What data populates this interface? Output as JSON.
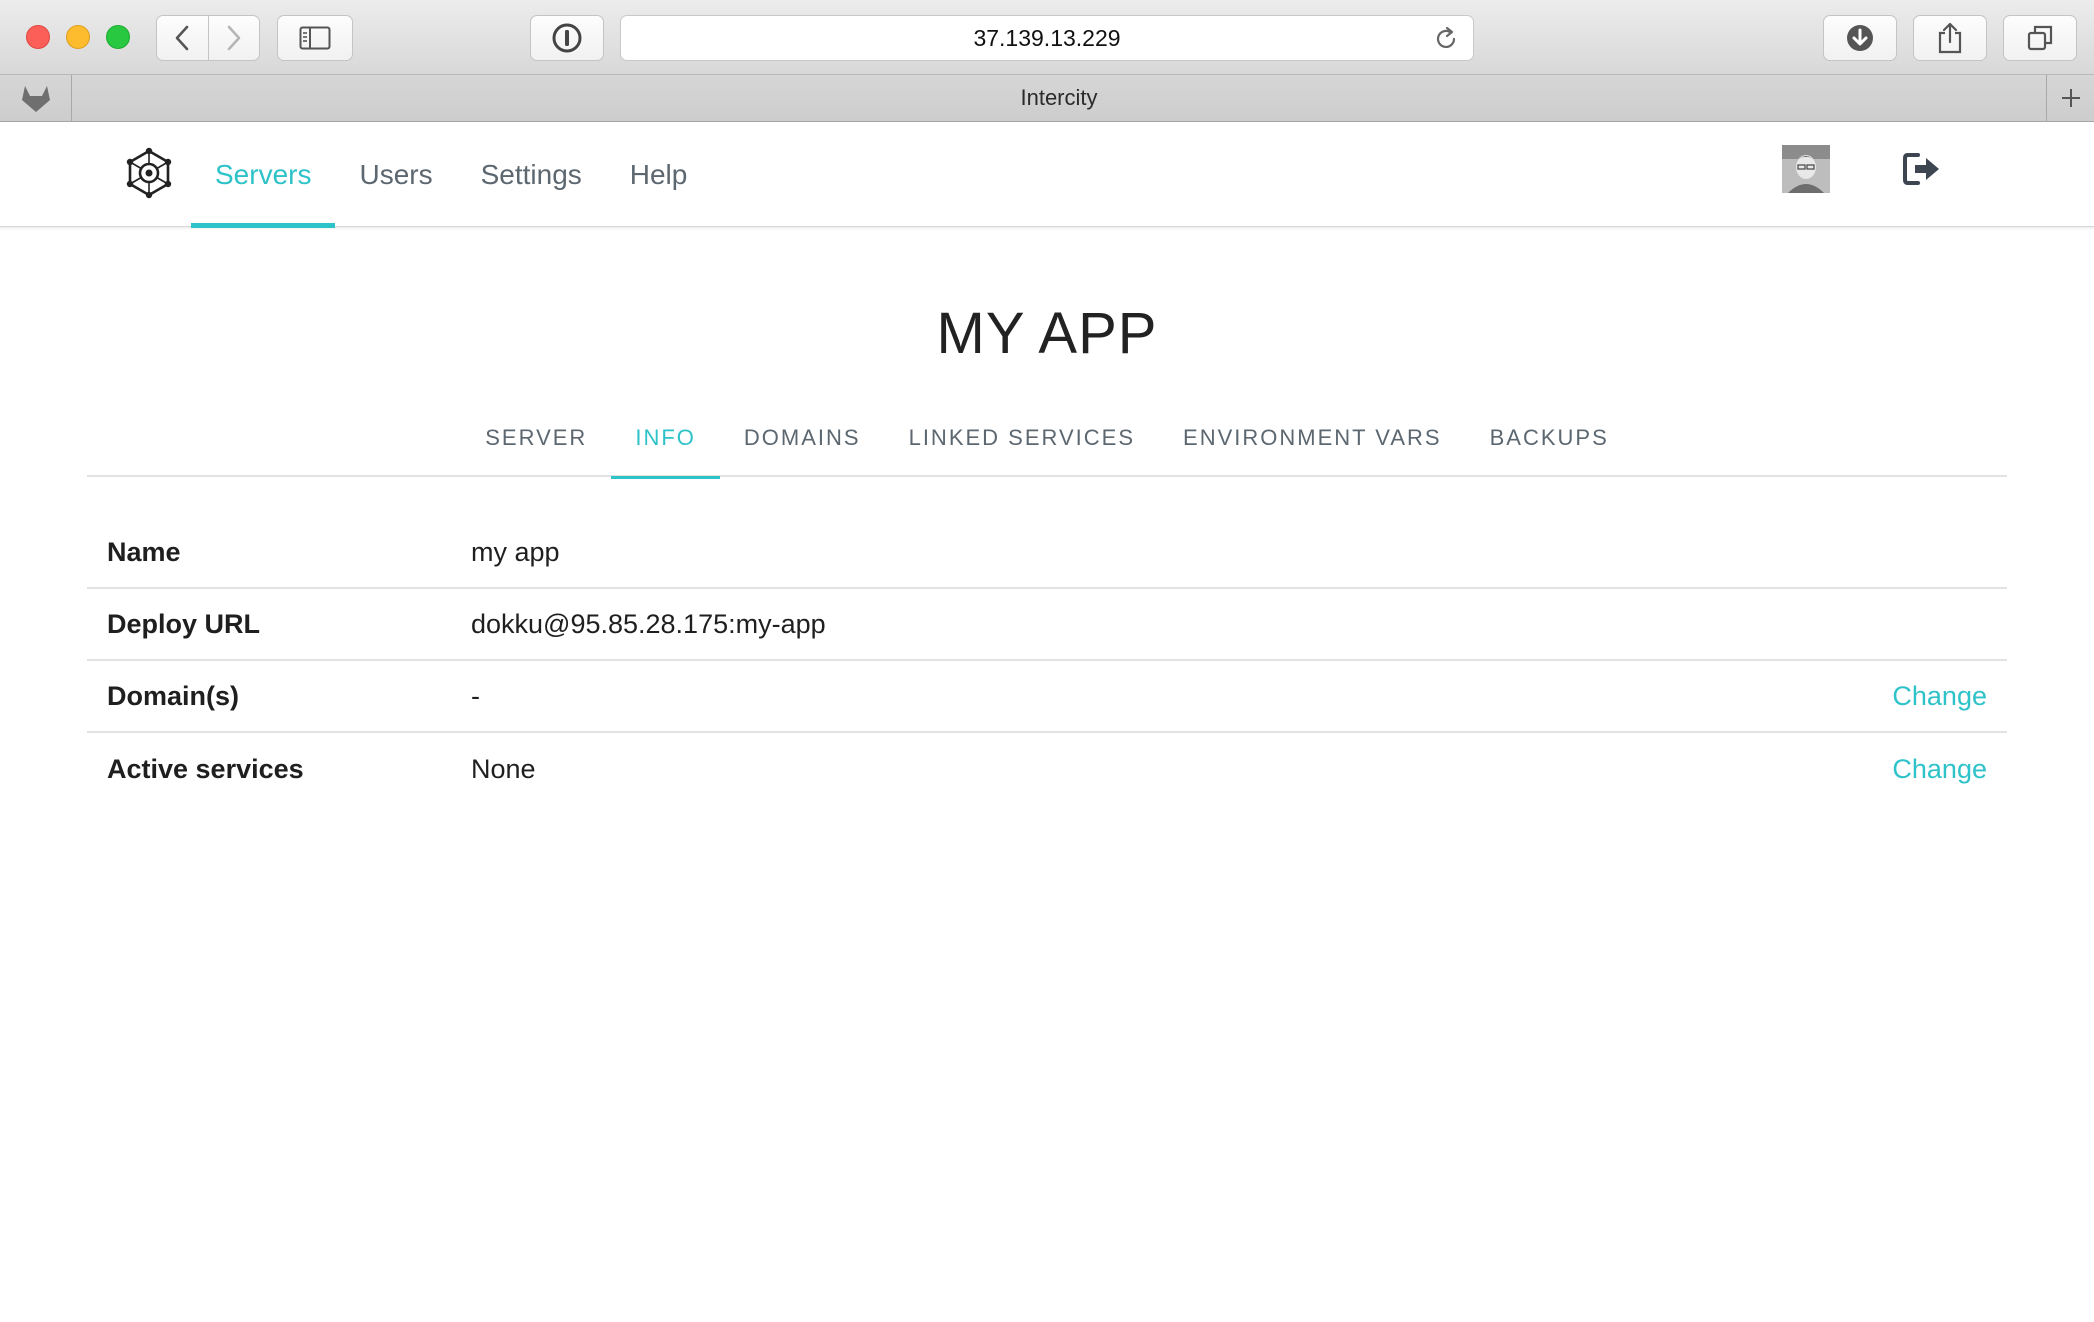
{
  "browser": {
    "address": "37.139.13.229",
    "tab_title": "Intercity"
  },
  "nav": {
    "links": [
      {
        "label": "Servers",
        "active": true
      },
      {
        "label": "Users",
        "active": false
      },
      {
        "label": "Settings",
        "active": false
      },
      {
        "label": "Help",
        "active": false
      }
    ]
  },
  "page": {
    "title": "MY APP",
    "tabs": [
      {
        "label": "SERVER",
        "active": false
      },
      {
        "label": "INFO",
        "active": true
      },
      {
        "label": "DOMAINS",
        "active": false
      },
      {
        "label": "LINKED SERVICES",
        "active": false
      },
      {
        "label": "ENVIRONMENT VARS",
        "active": false
      },
      {
        "label": "BACKUPS",
        "active": false
      }
    ]
  },
  "info": {
    "rows": [
      {
        "label": "Name",
        "value": "my app",
        "action": ""
      },
      {
        "label": "Deploy URL",
        "value": "dokku@95.85.28.175:my-app",
        "action": ""
      },
      {
        "label": "Domain(s)",
        "value": "-",
        "action": "Change"
      },
      {
        "label": "Active services",
        "value": "None",
        "action": "Change"
      }
    ]
  },
  "theme": {
    "accent": "#2ec2c9",
    "nav_text": "#5c6770"
  },
  "icons": {
    "logo": "hexagon-gear-logo",
    "logout": "logout-icon",
    "pinned_tab": "gitlab-fox-icon"
  }
}
